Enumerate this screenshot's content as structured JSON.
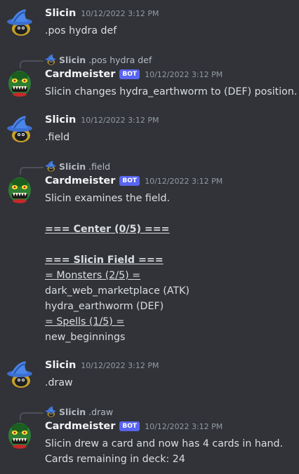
{
  "colors": {
    "background": "#313338",
    "bot_tag": "#5865f2",
    "username": "#f2f3f5",
    "timestamp": "#949ba4",
    "text": "#dbdee1"
  },
  "messages": [
    {
      "avatar_icon": "wizard-hat-avatar-icon",
      "username": "Slicin",
      "timestamp": "10/12/2022 3:12 PM",
      "lines": [
        ".pos hydra def"
      ]
    },
    {
      "reply": {
        "avatar_icon": "wizard-hat-avatar-icon",
        "username": "Slicin",
        "text": ".pos hydra def"
      },
      "avatar_icon": "goblin-avatar-icon",
      "username": "Cardmeister",
      "bot_tag": "BOT",
      "timestamp": "10/12/2022 3:12 PM",
      "lines": [
        "Slicin changes hydra_earthworm to (DEF) position."
      ]
    },
    {
      "avatar_icon": "wizard-hat-avatar-icon",
      "username": "Slicin",
      "timestamp": "10/12/2022 3:12 PM",
      "lines": [
        ".field"
      ]
    },
    {
      "reply": {
        "avatar_icon": "wizard-hat-avatar-icon",
        "username": "Slicin",
        "text": ".field"
      },
      "avatar_icon": "goblin-avatar-icon",
      "username": "Cardmeister",
      "bot_tag": "BOT",
      "timestamp": "10/12/2022 3:12 PM",
      "lines": [
        "Slicin examines the field.",
        "",
        "=== Center (0/5) ===",
        "",
        "=== Slicin Field ===",
        "= Monsters (2/5) =",
        "dark_web_marketplace (ATK)",
        "hydra_earthworm (DEF)",
        "= Spells (1/5) =",
        "new_beginnings"
      ]
    },
    {
      "avatar_icon": "wizard-hat-avatar-icon",
      "username": "Slicin",
      "timestamp": "10/12/2022 3:12 PM",
      "lines": [
        ".draw"
      ]
    },
    {
      "reply": {
        "avatar_icon": "wizard-hat-avatar-icon",
        "username": "Slicin",
        "text": ".draw"
      },
      "avatar_icon": "goblin-avatar-icon",
      "username": "Cardmeister",
      "bot_tag": "BOT",
      "timestamp": "10/12/2022 3:12 PM",
      "lines": [
        "Slicin drew a card and now has 4 cards in hand.",
        "Cards remaining in deck: 24"
      ]
    }
  ]
}
